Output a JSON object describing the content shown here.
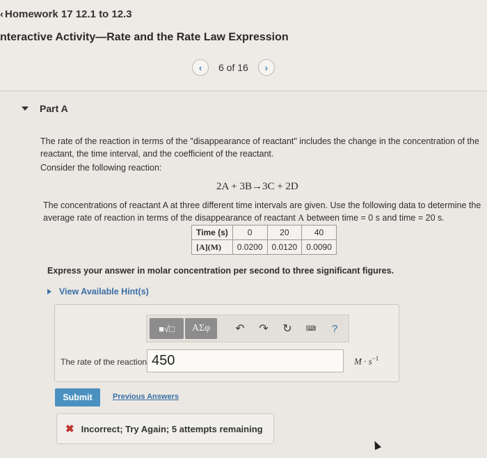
{
  "header": {
    "breadcrumb": "Homework 17 12.1 to 12.3",
    "title": "nteractive Activity—Rate and the Rate Law Expression",
    "pager": {
      "prev_icon": "‹",
      "label": "6 of 16",
      "next_icon": "›"
    }
  },
  "part": {
    "label": "Part A"
  },
  "problem": {
    "intro": "The rate of the reaction in terms of the \"disappearance of reactant\" includes the change in the concentration of the reactant, the time interval, and the coefficient of the reactant.",
    "consider": "Consider the following reaction:",
    "equation": "2A + 3B→3C + 2D",
    "data_intro_1": "The concentrations of reactant A at three different time intervals are given. Use the following data to determine the average rate of reaction in terms of the disappearance of reactant ",
    "reactant": "A",
    "data_intro_2": " between time = 0 s  and time = 20 s.",
    "table": {
      "header": [
        "Time (s)",
        "0",
        "20",
        "40"
      ],
      "row_label": "[A](M)",
      "row": [
        "0.0200",
        "0.0120",
        "0.0090"
      ]
    },
    "instruction": "Express your answer in molar concentration per second to three significant figures."
  },
  "hints": {
    "label": "View Available Hint(s)"
  },
  "toolbar": {
    "math_template": "■√□",
    "greek": "AΣφ",
    "undo": "↶",
    "redo": "↷",
    "reset": "↻",
    "keyboard": "⌨",
    "help": "?"
  },
  "answer": {
    "label": "The rate of the reaction =",
    "value": "450",
    "units": "M · s",
    "units_exp": "−1"
  },
  "actions": {
    "submit": "Submit",
    "previous": "Previous Answers"
  },
  "feedback": {
    "icon": "✖",
    "text": "Incorrect; Try Again; 5 attempts remaining"
  },
  "colors": {
    "accent": "#4a90c0",
    "link": "#3a6ea5",
    "error": "#c0322a"
  }
}
